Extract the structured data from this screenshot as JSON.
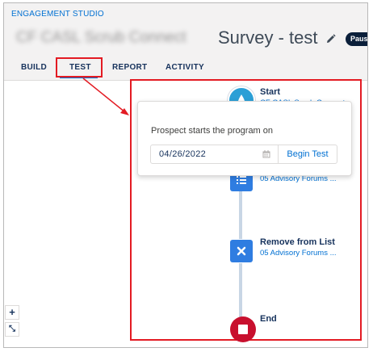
{
  "header": {
    "studio_label": "ENGAGEMENT STUDIO",
    "program_name_blurred": "CF CASL Scrub Connect",
    "title": "Survey - test",
    "status_badge": "Paused",
    "tabs": [
      {
        "label": "BUILD"
      },
      {
        "label": "TEST"
      },
      {
        "label": "REPORT"
      },
      {
        "label": "ACTIVITY"
      }
    ],
    "active_tab": "TEST"
  },
  "flow": {
    "start": {
      "title": "Start",
      "subtitle": "CF CASL Scrub Connect",
      "icon": "droplet-icon"
    },
    "step1": {
      "subtitle": "05 Advisory Forums ...",
      "icon": "list-icon"
    },
    "step2": {
      "title": "Remove from List",
      "subtitle": "05 Advisory Forums ...",
      "icon": "close-icon"
    },
    "end": {
      "title": "End",
      "icon": "stop-icon"
    }
  },
  "test_popover": {
    "label": "Prospect starts the program on",
    "date_value": "04/26/2022",
    "begin_label": "Begin Test"
  },
  "zoom": {
    "zoom_in": "+",
    "fit": "⤡"
  },
  "colors": {
    "annotation_red": "#e31b23",
    "link_blue": "#0070d2",
    "start_blue": "#2a9fd6",
    "action_blue": "#2f7de1",
    "end_red": "#c8102e"
  }
}
